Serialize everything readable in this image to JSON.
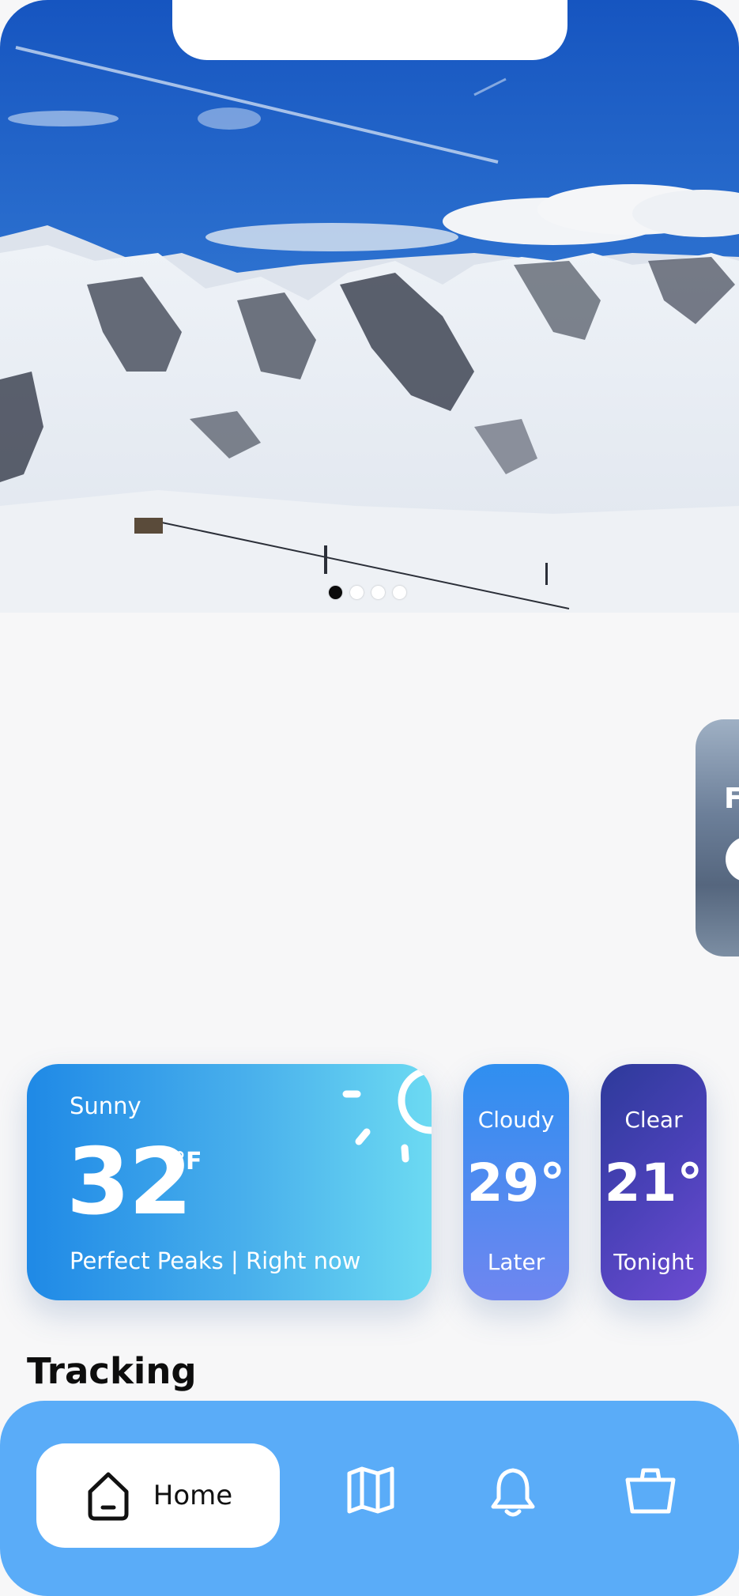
{
  "carousel": {
    "page_count": 4,
    "active_index": 0
  },
  "peek_card": {
    "visible_letter": "F"
  },
  "weather": {
    "now": {
      "condition": "Sunny",
      "temperature": "32",
      "unit": "°F",
      "subtitle": "Perfect Peaks | Right now",
      "icon": "sun-icon"
    },
    "later": {
      "condition": "Cloudy",
      "temperature": "29°",
      "time_label": "Later"
    },
    "tonight": {
      "condition": "Clear",
      "temperature": "21°",
      "time_label": "Tonight"
    }
  },
  "tracking": {
    "heading": "Tracking"
  },
  "nav": {
    "home_label": "Home",
    "items": [
      "home-icon",
      "map-icon",
      "bell-icon",
      "briefcase-icon"
    ],
    "background_color": "#5aacf8"
  }
}
